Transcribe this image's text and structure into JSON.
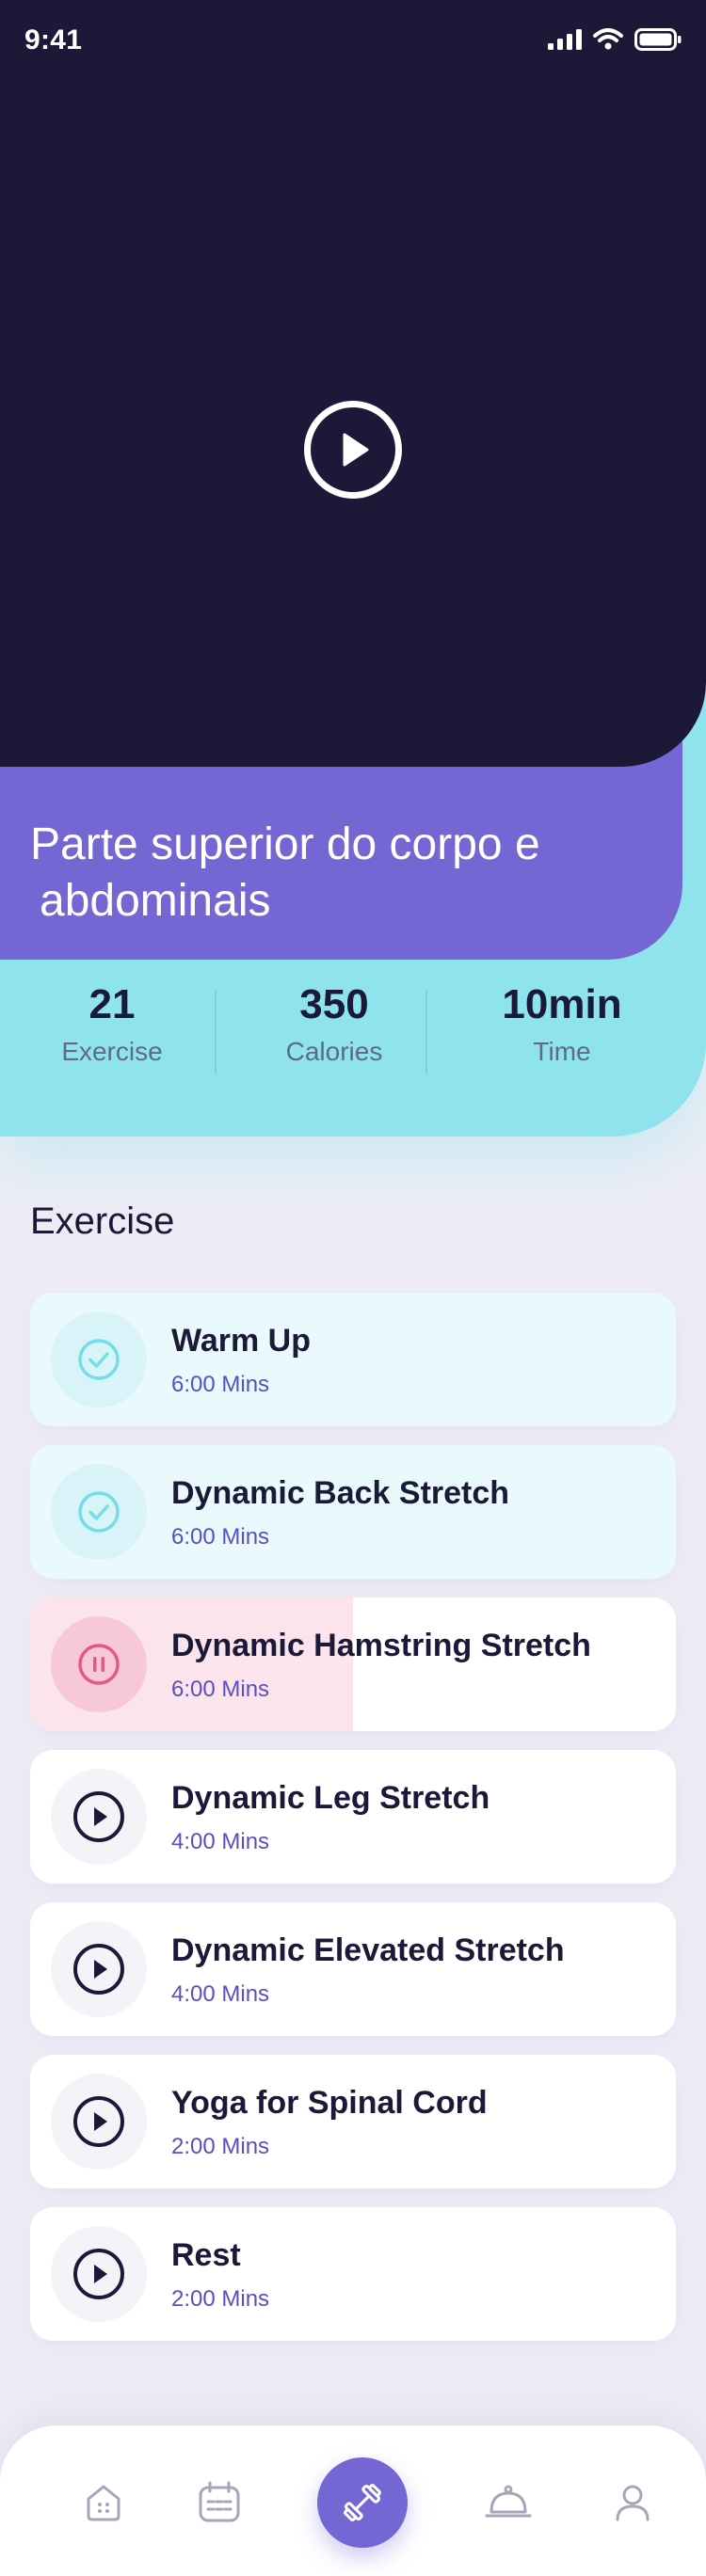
{
  "status_bar": {
    "time": "9:41"
  },
  "workout": {
    "title_line1": "Parte superior do corpo e",
    "title_line2": "abdominais"
  },
  "stats": [
    {
      "value": "21",
      "label": "Exercise"
    },
    {
      "value": "350",
      "label": "Calories"
    },
    {
      "value": "10min",
      "label": "Time"
    }
  ],
  "section_title": "Exercise",
  "exercises": [
    {
      "name": "Warm Up",
      "duration": "6:00 Mins",
      "state": "done",
      "icon": "check-icon"
    },
    {
      "name": "Dynamic Back Stretch",
      "duration": "6:00 Mins",
      "state": "done",
      "icon": "check-icon"
    },
    {
      "name": "Dynamic Hamstring Stretch",
      "duration": "6:00 Mins",
      "state": "in-progress",
      "progress": 0.5,
      "icon": "pause-icon"
    },
    {
      "name": "Dynamic Leg Stretch",
      "duration": "4:00 Mins",
      "state": "pending",
      "icon": "play-icon"
    },
    {
      "name": "Dynamic Elevated Stretch",
      "duration": "4:00 Mins",
      "state": "pending",
      "icon": "play-icon"
    },
    {
      "name": "Yoga for Spinal Cord",
      "duration": "2:00 Mins",
      "state": "pending",
      "icon": "play-icon"
    },
    {
      "name": "Rest",
      "duration": "2:00 Mins",
      "state": "pending",
      "icon": "play-icon"
    }
  ],
  "tabbar": {
    "tabs": [
      "home-icon",
      "calendar-icon",
      "dumbbell-icon",
      "cloche-icon",
      "profile-icon"
    ],
    "active": "dumbbell-icon"
  },
  "colors": {
    "video_bg": "#1B1838",
    "accent_purple": "#7466D3",
    "accent_cyan": "#8FE3EC",
    "done_check": "#74DDE8",
    "active_pink": "#E05A85"
  }
}
